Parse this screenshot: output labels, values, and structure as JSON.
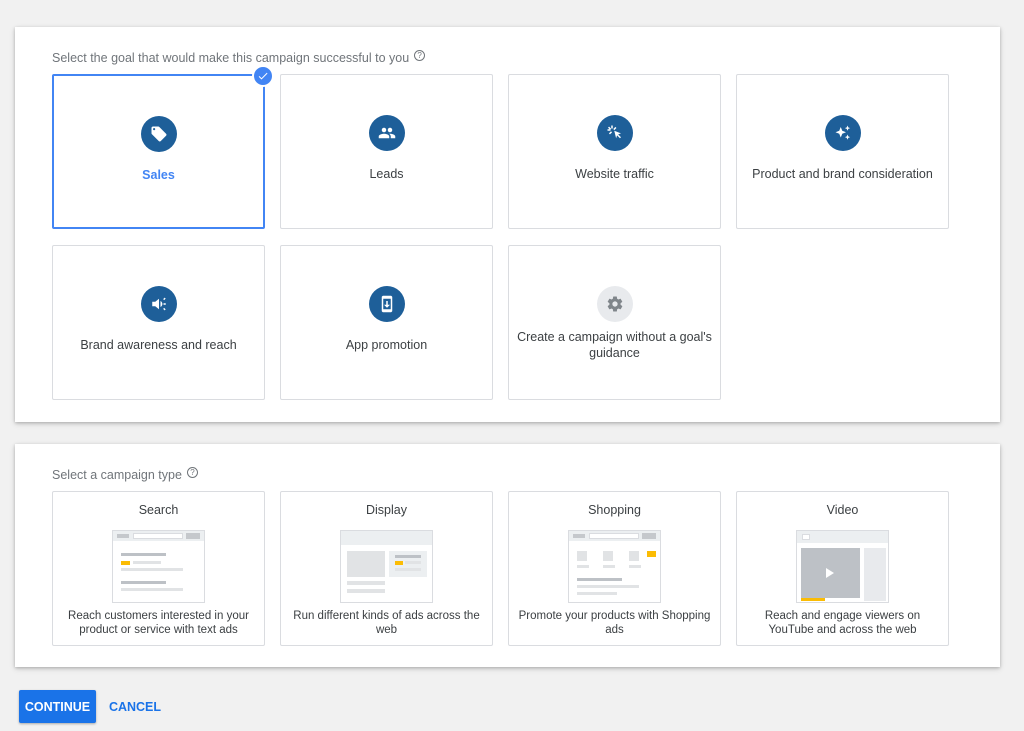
{
  "goal_section": {
    "heading": "Select the goal that would make this campaign successful to you",
    "help_icon": "help-circle-icon",
    "goals": [
      {
        "label": "Sales",
        "icon": "tag-icon",
        "selected": true
      },
      {
        "label": "Leads",
        "icon": "people-icon",
        "selected": false
      },
      {
        "label": "Website traffic",
        "icon": "cursor-click-icon",
        "selected": false
      },
      {
        "label": "Product and brand consideration",
        "icon": "sparkle-icon",
        "selected": false
      },
      {
        "label": "Brand awareness and reach",
        "icon": "megaphone-icon",
        "selected": false
      },
      {
        "label": "App promotion",
        "icon": "phone-download-icon",
        "selected": false
      },
      {
        "label": "Create a campaign without a goal's guidance",
        "icon": "gear-icon",
        "selected": false
      }
    ]
  },
  "type_section": {
    "heading": "Select a campaign type",
    "help_icon": "help-circle-icon",
    "types": [
      {
        "title": "Search",
        "description": "Reach customers interested in your product or service with text ads"
      },
      {
        "title": "Display",
        "description": "Run different kinds of ads across the web"
      },
      {
        "title": "Shopping",
        "description": "Promote your products with Shopping ads"
      },
      {
        "title": "Video",
        "description": "Reach and engage viewers on YouTube and across the web"
      }
    ]
  },
  "actions": {
    "continue_label": "CONTINUE",
    "cancel_label": "CANCEL"
  },
  "colors": {
    "accent": "#4285f4",
    "primary_button": "#1a73e8",
    "icon_circle": "#1e5f99",
    "illustration_highlight": "#fbbc04"
  }
}
